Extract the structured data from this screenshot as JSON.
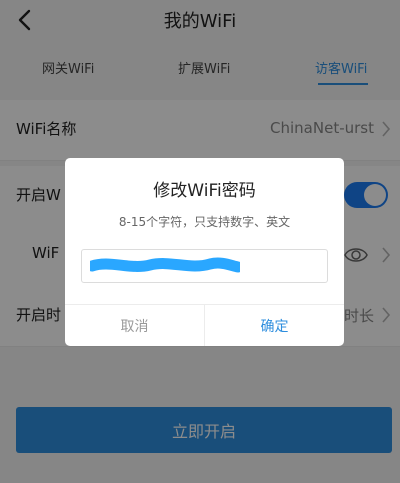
{
  "header": {
    "title": "我的WiFi",
    "back_icon": "chevron-left-icon"
  },
  "tabs": [
    {
      "label": "网关WiFi",
      "active": false
    },
    {
      "label": "扩展WiFi",
      "active": false
    },
    {
      "label": "访客WiFi",
      "active": true
    }
  ],
  "settings": {
    "wifi_name": {
      "label": "WiFi名称",
      "value": "ChinaNet-urst"
    },
    "enable_wifi": {
      "label": "开启W",
      "enabled": true
    },
    "password_row": {
      "label": "WiF"
    },
    "duration": {
      "label": "开启时",
      "value": "时长"
    }
  },
  "cta": {
    "label": "立即开启"
  },
  "dialog": {
    "title": "修改WiFi密码",
    "hint": "8-15个字符，只支持数字、英文",
    "input_value": "",
    "cancel_label": "取消",
    "confirm_label": "确定"
  },
  "colors": {
    "accent": "#2e8ede",
    "toggle_on": "#1d7cf2",
    "redaction": "#2aa7ff"
  }
}
